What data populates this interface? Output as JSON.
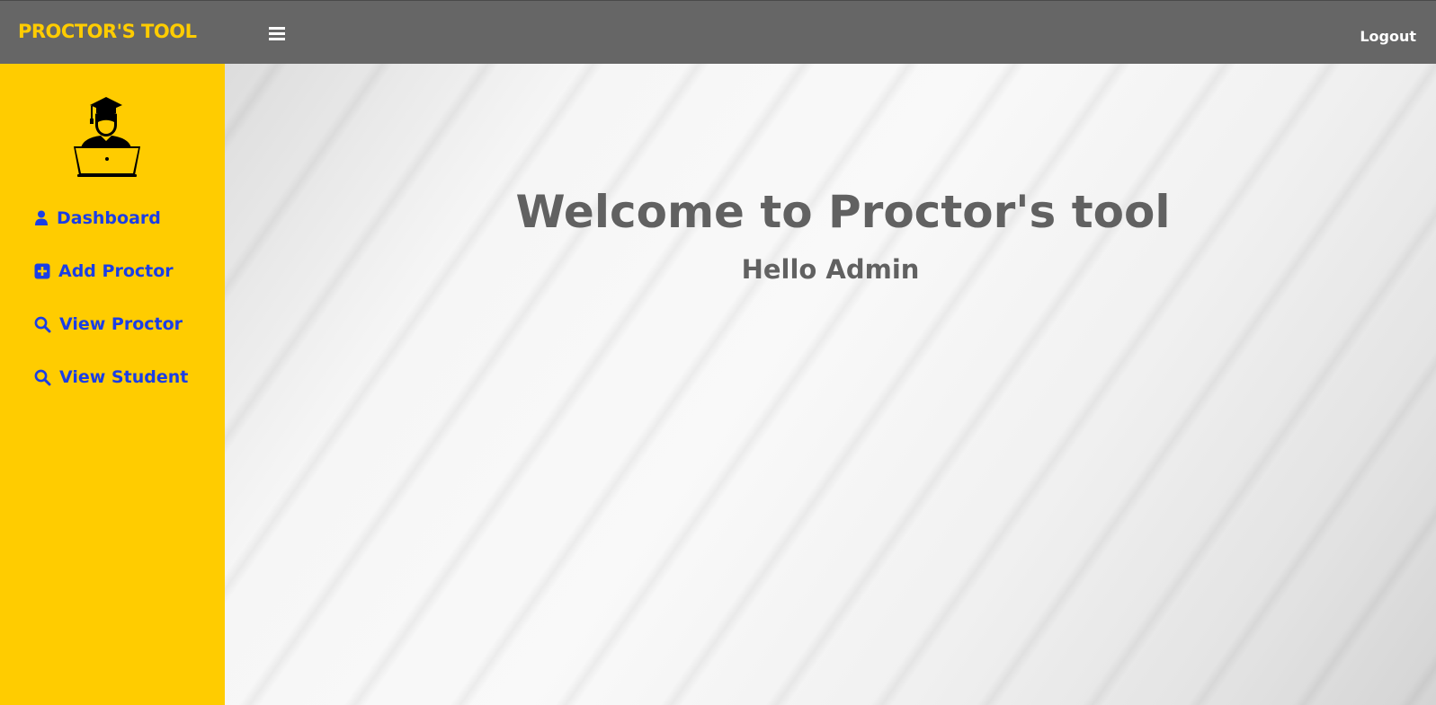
{
  "header": {
    "brand": "PROCTOR'S TOOL",
    "menu_icon": "hamburger-menu-icon",
    "logout_label": "Logout"
  },
  "sidebar": {
    "avatar_icon": "graduate-with-laptop-icon",
    "items": [
      {
        "label": "Dashboard",
        "icon": "user-icon"
      },
      {
        "label": "Add Proctor",
        "icon": "plus-square-icon"
      },
      {
        "label": "View Proctor",
        "icon": "search-icon"
      },
      {
        "label": "View Student",
        "icon": "search-icon"
      }
    ]
  },
  "main": {
    "welcome_title": "Welcome to Proctor's tool",
    "greeting": "Hello Admin"
  },
  "colors": {
    "header_bg": "#666666",
    "brand": "#ffcc00",
    "sidebar_bg": "#ffcc00",
    "nav_link": "#1a3ee6",
    "heading_text": "#616161"
  }
}
